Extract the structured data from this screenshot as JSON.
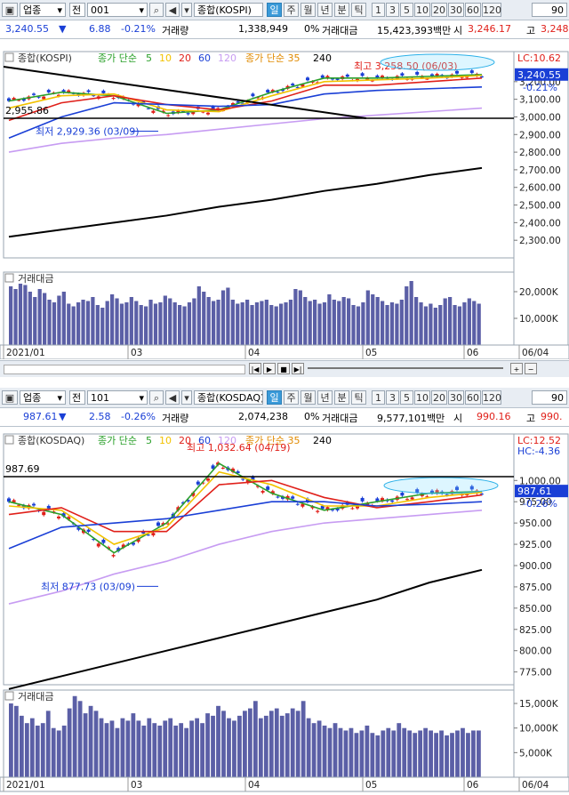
{
  "top": {
    "toolbar": {
      "market": "업종",
      "code_label": "전",
      "code": "001",
      "name": "종합(KOSPI)",
      "periods": [
        "일",
        "주",
        "월",
        "년",
        "분",
        "틱"
      ],
      "numbers": [
        "1",
        "3",
        "5",
        "10",
        "20",
        "30",
        "60",
        "120"
      ],
      "right": "90"
    },
    "quote": {
      "price": "3,240.55",
      "change": "6.88",
      "rate": "-0.21%",
      "volume_label": "거래량",
      "volume": "1,338,949",
      "volume_pct": "0%",
      "amount_label": "거래대금",
      "amount": "15,423,393백만",
      "open_label": "시",
      "open": "3,246.17",
      "high_label": "고",
      "high": "3,248"
    },
    "legend": {
      "index": "종합(KOSPI)",
      "ma_label": "종가 단순",
      "ma_periods": [
        "5",
        "10",
        "20",
        "60",
        "120"
      ],
      "ma2_label": "종가 단순 35",
      "ma2_value": "240"
    },
    "overlay": {
      "lc": "LC:10.62",
      "last": "3,240.55",
      "last_rate": "-0.21%",
      "max_label": "최고 3,258.50 (06/03)",
      "min_label": "최저 2,929.36 (03/09)",
      "left_label": "2,955.86"
    },
    "vol_title": "거래대금",
    "x_labels": [
      "2021/01",
      "03",
      "04",
      "05",
      "06",
      "06/04"
    ]
  },
  "bottom": {
    "toolbar": {
      "market": "업종",
      "code_label": "전",
      "code": "101",
      "name": "종합(KOSDAQ)",
      "periods": [
        "일",
        "주",
        "월",
        "년",
        "분",
        "틱"
      ],
      "numbers": [
        "1",
        "3",
        "5",
        "10",
        "20",
        "30",
        "60",
        "120"
      ],
      "right": "90"
    },
    "quote": {
      "price": "987.61",
      "change": "2.58",
      "rate": "-0.26%",
      "volume_label": "거래량",
      "volume": "2,074,238",
      "volume_pct": "0%",
      "amount_label": "거래대금",
      "amount": "9,577,101백만",
      "open_label": "시",
      "open": "990.16",
      "high_label": "고",
      "high": "990."
    },
    "legend": {
      "index": "종합(KOSDAQ)",
      "ma_label": "종가 단순",
      "ma_periods": [
        "5",
        "10",
        "20",
        "60",
        "120"
      ],
      "ma2_label": "종가 단순 35",
      "ma2_value": "240"
    },
    "overlay": {
      "lc": "LC:12.52",
      "hc": "HC:-4.36",
      "last": "987.61",
      "last_rate": "-0.26%",
      "max_label": "최고 1,032.64 (04/19)",
      "min_label": "최저 877.73 (03/09)",
      "left_label": "987.69"
    },
    "vol_title": "거래대금",
    "x_labels": [
      "2021/01",
      "03",
      "04",
      "05",
      "06",
      "06/04"
    ]
  },
  "colors": {
    "up": "#e0201a",
    "down": "#1a3fd6",
    "ma5": "#2aa02a",
    "ma10": "#f2c200",
    "ma20": "#e0201a",
    "ma60": "#1a3fd6",
    "ma120": "#c79cf2",
    "ma240": "#000000",
    "volume": "#5b5fa6"
  },
  "chart_data": [
    {
      "type": "line",
      "title": "종합(KOSPI)",
      "ylim": [
        2200,
        3300
      ],
      "y_ticks": [
        2300,
        2400,
        2500,
        2600,
        2700,
        2800,
        2900,
        3000,
        3100,
        3200
      ],
      "y_tick_labels": [
        "2,300.00",
        "2,400.00",
        "2,500.00",
        "2,600.00",
        "2,700.00",
        "2,800.00",
        "2,900.00",
        "3,000.00",
        "3,100.00",
        "3,200.00"
      ],
      "x": [
        "2021/01",
        "03",
        "04",
        "05",
        "06"
      ],
      "series": [
        {
          "name": "5",
          "values": [
            3090,
            3140,
            3120,
            3020,
            3040,
            3140,
            3220,
            3220,
            3230,
            3240
          ]
        },
        {
          "name": "10",
          "values": [
            3050,
            3120,
            3130,
            3040,
            3030,
            3120,
            3200,
            3210,
            3220,
            3235
          ]
        },
        {
          "name": "20",
          "values": [
            2980,
            3080,
            3120,
            3070,
            3040,
            3090,
            3180,
            3180,
            3200,
            3220
          ]
        },
        {
          "name": "60",
          "values": [
            2880,
            3000,
            3080,
            3070,
            3060,
            3070,
            3130,
            3150,
            3160,
            3170
          ]
        },
        {
          "name": "120",
          "values": [
            2800,
            2850,
            2880,
            2900,
            2930,
            2960,
            2990,
            3010,
            3030,
            3050
          ]
        },
        {
          "name": "240",
          "values": [
            2320,
            2360,
            2400,
            2440,
            2490,
            2530,
            2580,
            2620,
            2670,
            2710
          ]
        }
      ],
      "close_last": 3240.55,
      "high": 3258.5,
      "low": 2929.36,
      "volume": {
        "y_ticks": [
          10000,
          20000
        ],
        "y_tick_labels": [
          "10,000K",
          "20,000K"
        ],
        "ylim": [
          0,
          26000
        ],
        "values": [
          22000,
          21000,
          23000,
          22500,
          20000,
          18000,
          21000,
          19500,
          17000,
          16000,
          18500,
          20000,
          15500,
          14500,
          16000,
          17000,
          16500,
          18000,
          15000,
          14000,
          16500,
          19000,
          17500,
          15500,
          16000,
          18000,
          16500,
          15000,
          14500,
          17000,
          15500,
          16000,
          18500,
          17500,
          16000,
          15000,
          14500,
          16000,
          17500,
          22000,
          20000,
          18000,
          16500,
          17000,
          20500,
          21500,
          17000,
          15500,
          16000,
          17000,
          15000,
          16000,
          16500,
          17000,
          15000,
          14500,
          15500,
          16000,
          17000,
          21000,
          20500,
          18000,
          16500,
          17000,
          15500,
          16000,
          19000,
          17000,
          16500,
          18000,
          17500,
          15000,
          14500,
          16000,
          20500,
          19000,
          18000,
          16500,
          15000,
          16000,
          15500,
          17000,
          22000,
          24000,
          18000,
          16000,
          14500,
          15500,
          14000,
          15000,
          17500,
          18000,
          15000,
          14500,
          16000,
          17500,
          16500,
          15500
        ]
      }
    },
    {
      "type": "line",
      "title": "종합(KOSDAQ)",
      "ylim": [
        760,
        1040
      ],
      "y_ticks": [
        775,
        800,
        825,
        850,
        875,
        900,
        925,
        950,
        975,
        1000
      ],
      "y_tick_labels": [
        "775.00",
        "800.00",
        "825.00",
        "850.00",
        "875.00",
        "900.00",
        "925.00",
        "950.00",
        "975.00",
        "1,000.00"
      ],
      "x": [
        "2021/01",
        "03",
        "04",
        "05",
        "06"
      ],
      "series": [
        {
          "name": "5",
          "values": [
            975,
            960,
            915,
            950,
            1020,
            985,
            965,
            975,
            985,
            987
          ]
        },
        {
          "name": "10",
          "values": [
            970,
            965,
            925,
            945,
            1010,
            995,
            970,
            970,
            980,
            986
          ]
        },
        {
          "name": "20",
          "values": [
            960,
            968,
            940,
            940,
            995,
            1000,
            980,
            968,
            975,
            983
          ]
        },
        {
          "name": "60",
          "values": [
            920,
            945,
            950,
            955,
            965,
            975,
            975,
            970,
            972,
            975
          ]
        },
        {
          "name": "120",
          "values": [
            855,
            870,
            890,
            905,
            925,
            940,
            950,
            955,
            960,
            965
          ]
        },
        {
          "name": "240",
          "values": [
            755,
            770,
            785,
            800,
            815,
            830,
            845,
            860,
            880,
            895
          ]
        }
      ],
      "close_last": 987.61,
      "high": 1032.64,
      "low": 877.73,
      "volume": {
        "y_ticks": [
          5000,
          10000,
          15000
        ],
        "y_tick_labels": [
          "5,000K",
          "10,000K",
          "15,000K"
        ],
        "ylim": [
          0,
          17000
        ],
        "values": [
          15000,
          14500,
          12500,
          11000,
          12000,
          10500,
          11000,
          13500,
          10000,
          9500,
          10500,
          14000,
          16500,
          15500,
          13000,
          14500,
          13500,
          12000,
          11000,
          11500,
          10000,
          12000,
          11500,
          13000,
          11500,
          10500,
          12000,
          11000,
          10500,
          11500,
          12000,
          10500,
          11000,
          10000,
          11500,
          12000,
          11000,
          13000,
          12500,
          14500,
          13500,
          12000,
          11500,
          12500,
          13500,
          14000,
          15500,
          12000,
          12500,
          13500,
          14000,
          12500,
          13000,
          14000,
          13500,
          15500,
          12000,
          11000,
          11500,
          10500,
          10000,
          11000,
          10000,
          9500,
          10000,
          9000,
          9500,
          10500,
          9000,
          8500,
          9500,
          10000,
          9500,
          11000,
          10000,
          9500,
          9000,
          9500,
          10000,
          9500,
          9000,
          9500,
          8500,
          9000,
          9500,
          10000,
          9000,
          9500,
          9500
        ]
      }
    }
  ]
}
